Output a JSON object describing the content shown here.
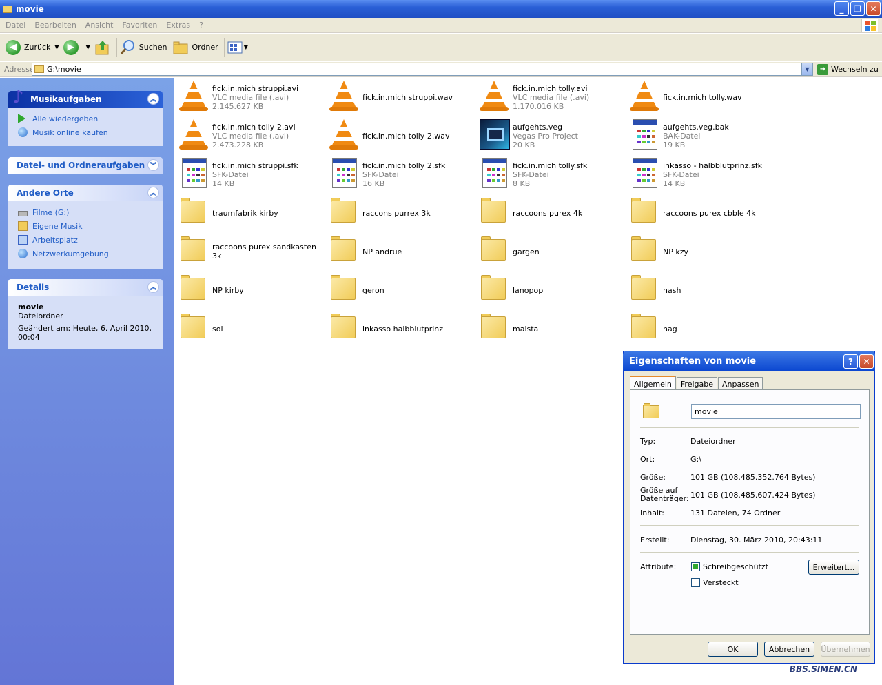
{
  "window": {
    "title": "movie",
    "min": "_",
    "max": "❐",
    "close": "✕"
  },
  "menu": [
    "Datei",
    "Bearbeiten",
    "Ansicht",
    "Favoriten",
    "Extras",
    "?"
  ],
  "toolbar": {
    "back": "Zurück",
    "search": "Suchen",
    "folders": "Ordner"
  },
  "address": {
    "label": "Adresse",
    "value": "G:\\movie",
    "go": "Wechseln zu"
  },
  "sidebar": {
    "music": {
      "title": "Musikaufgaben",
      "items": [
        "Alle wiedergeben",
        "Musik online kaufen"
      ]
    },
    "file_tasks": {
      "title": "Datei- und Ordneraufgaben"
    },
    "other_places": {
      "title": "Andere Orte",
      "items": [
        "Filme (G:)",
        "Eigene Musik",
        "Arbeitsplatz",
        "Netzwerkumgebung"
      ]
    },
    "details": {
      "title": "Details",
      "name": "movie",
      "type": "Dateiordner",
      "modified": "Geändert am: Heute, 6. April 2010, 00:04"
    }
  },
  "files": [
    {
      "name": "fick.in.mich struppi.avi",
      "type": "VLC media file (.avi)",
      "size": "2.145.627 KB",
      "icon": "vlc-icon"
    },
    {
      "name": "fick.in.mich struppi.wav",
      "type": "",
      "size": "",
      "icon": "vlc-icon"
    },
    {
      "name": "fick.in.mich tolly.avi",
      "type": "VLC media file (.avi)",
      "size": "1.170.016 KB",
      "icon": "vlc-icon"
    },
    {
      "name": "fick.in.mich tolly.wav",
      "type": "",
      "size": "",
      "icon": "vlc-icon"
    },
    {
      "name": "fick.in.mich tolly 2.avi",
      "type": "VLC media file (.avi)",
      "size": "2.473.228 KB",
      "icon": "vlc-icon"
    },
    {
      "name": "fick.in.mich tolly 2.wav",
      "type": "",
      "size": "",
      "icon": "vlc-icon"
    },
    {
      "name": "aufgehts.veg",
      "type": "Vegas Pro Project",
      "size": "20 KB",
      "icon": "vegas-icon"
    },
    {
      "name": "aufgehts.veg.bak",
      "type": "BAK-Datei",
      "size": "19 KB",
      "icon": "document-icon"
    },
    {
      "name": "fick.in.mich struppi.sfk",
      "type": "SFK-Datei",
      "size": "14 KB",
      "icon": "document-icon"
    },
    {
      "name": "fick.in.mich tolly 2.sfk",
      "type": "SFK-Datei",
      "size": "16 KB",
      "icon": "document-icon"
    },
    {
      "name": "fick.in.mich tolly.sfk",
      "type": "SFK-Datei",
      "size": "8 KB",
      "icon": "document-icon"
    },
    {
      "name": "inkasso - halbblutprinz.sfk",
      "type": "SFK-Datei",
      "size": "14 KB",
      "icon": "document-icon"
    },
    {
      "name": "traumfabrik kirby",
      "type": "",
      "size": "",
      "icon": "folder-icon"
    },
    {
      "name": "raccons purrex 3k",
      "type": "",
      "size": "",
      "icon": "folder-icon"
    },
    {
      "name": "raccoons purex 4k",
      "type": "",
      "size": "",
      "icon": "folder-icon"
    },
    {
      "name": "raccoons purex cbble 4k",
      "type": "",
      "size": "",
      "icon": "folder-icon"
    },
    {
      "name": "raccoons purex sandkasten 3k",
      "type": "",
      "size": "",
      "icon": "folder-icon"
    },
    {
      "name": "NP andrue",
      "type": "",
      "size": "",
      "icon": "folder-icon"
    },
    {
      "name": "gargen",
      "type": "",
      "size": "",
      "icon": "folder-icon"
    },
    {
      "name": "NP kzy",
      "type": "",
      "size": "",
      "icon": "folder-icon"
    },
    {
      "name": "NP kirby",
      "type": "",
      "size": "",
      "icon": "folder-icon"
    },
    {
      "name": "geron",
      "type": "",
      "size": "",
      "icon": "folder-icon"
    },
    {
      "name": "lanopop",
      "type": "",
      "size": "",
      "icon": "folder-icon"
    },
    {
      "name": "nash",
      "type": "",
      "size": "",
      "icon": "folder-icon"
    },
    {
      "name": "sol",
      "type": "",
      "size": "",
      "icon": "folder-icon"
    },
    {
      "name": "inkasso halbblutprinz",
      "type": "",
      "size": "",
      "icon": "folder-icon"
    },
    {
      "name": "maista",
      "type": "",
      "size": "",
      "icon": "folder-icon"
    },
    {
      "name": "nag",
      "type": "",
      "size": "",
      "icon": "folder-icon"
    }
  ],
  "dialog": {
    "title": "Eigenschaften von movie",
    "help": "?",
    "close": "✕",
    "tabs": [
      "Allgemein",
      "Freigabe",
      "Anpassen"
    ],
    "name": "movie",
    "fields": [
      {
        "label": "Typ:",
        "value": "Dateiordner"
      },
      {
        "label": "Ort:",
        "value": "G:\\"
      },
      {
        "label": "Größe:",
        "value": "101 GB (108.485.352.764 Bytes)"
      },
      {
        "label": "Größe auf Datenträger:",
        "value": "101 GB (108.485.607.424 Bytes)"
      },
      {
        "label": "Inhalt:",
        "value": "131 Dateien, 74 Ordner"
      }
    ],
    "created_label": "Erstellt:",
    "created": "Dienstag, 30. März 2010, 20:43:11",
    "attributes_label": "Attribute:",
    "readonly": "Schreibgeschützt",
    "hidden": "Versteckt",
    "advanced": "Erweitert...",
    "ok": "OK",
    "cancel": "Abbrechen",
    "apply": "Übernehmen"
  },
  "watermark": "BBS.SIMEN.CN"
}
